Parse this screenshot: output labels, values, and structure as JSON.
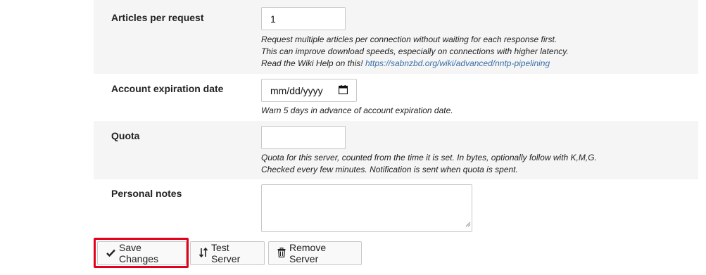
{
  "form": {
    "articles": {
      "label": "Articles per request",
      "value": "1",
      "desc_line1": "Request multiple articles per connection without waiting for each response first.",
      "desc_line2": "This can improve download speeds, especially on connections with higher latency.",
      "desc_line3_prefix": "Read the Wiki Help on this!",
      "desc_link": "https://sabnzbd.org/wiki/advanced/nntp-pipelining"
    },
    "expiration": {
      "label": "Account expiration date",
      "placeholder": "mm/dd/yyyy",
      "desc": "Warn 5 days in advance of account expiration date."
    },
    "quota": {
      "label": "Quota",
      "value": "",
      "desc_line1": "Quota for this server, counted from the time it is set. In bytes, optionally follow with K,M,G.",
      "desc_line2": "Checked every few minutes. Notification is sent when quota is spent."
    },
    "notes": {
      "label": "Personal notes",
      "value": ""
    }
  },
  "buttons": {
    "save": "Save Changes",
    "test": "Test Server",
    "remove": "Remove Server"
  },
  "icons": {
    "save": "check-icon",
    "test": "sort-arrows-icon",
    "remove": "trash-icon",
    "calendar": "calendar-icon"
  },
  "colors": {
    "row_shade": "#f5f5f5",
    "link": "#3a6fa8",
    "highlight": "#e3001b"
  }
}
